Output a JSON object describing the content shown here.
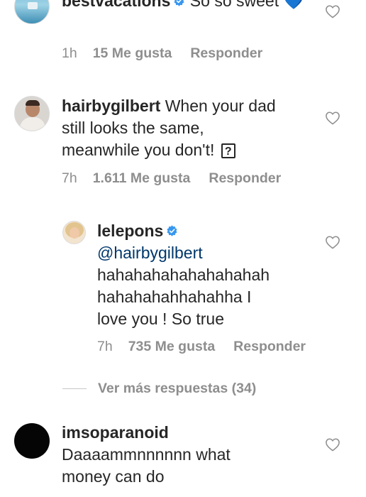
{
  "comments": [
    {
      "username": "bestvacations",
      "verified": true,
      "text": "So so sweet",
      "emoji": "💙",
      "time": "1h",
      "likes": "15 Me gusta",
      "reply": "Responder"
    },
    {
      "username": "hairbygilbert",
      "verified": false,
      "text_lines": [
        "When your dad",
        "still looks the same,",
        "meanwhile you don't!"
      ],
      "emoji": "?",
      "time": "7h",
      "likes": "1.611 Me gusta",
      "reply": "Responder"
    },
    {
      "username": "lelepons",
      "verified": true,
      "mention": "@hairbygilbert",
      "text_lines": [
        "hahahahahahahahahah",
        "hahahahahhahahha I",
        "love you ! So true"
      ],
      "time": "7h",
      "likes": "735 Me gusta",
      "reply": "Responder"
    },
    {
      "username": "imsoparanoid",
      "verified": false,
      "text_lines": [
        "Daaaammnnnnnn what",
        "money can do"
      ]
    }
  ],
  "view_more": "Ver más respuestas (34)",
  "colors": {
    "verified": "#3897f0",
    "mention": "#00376b",
    "secondary": "#8e8e8e"
  },
  "icons": [
    "heart-outline-icon",
    "verified-badge-icon",
    "blue-heart-emoji"
  ]
}
